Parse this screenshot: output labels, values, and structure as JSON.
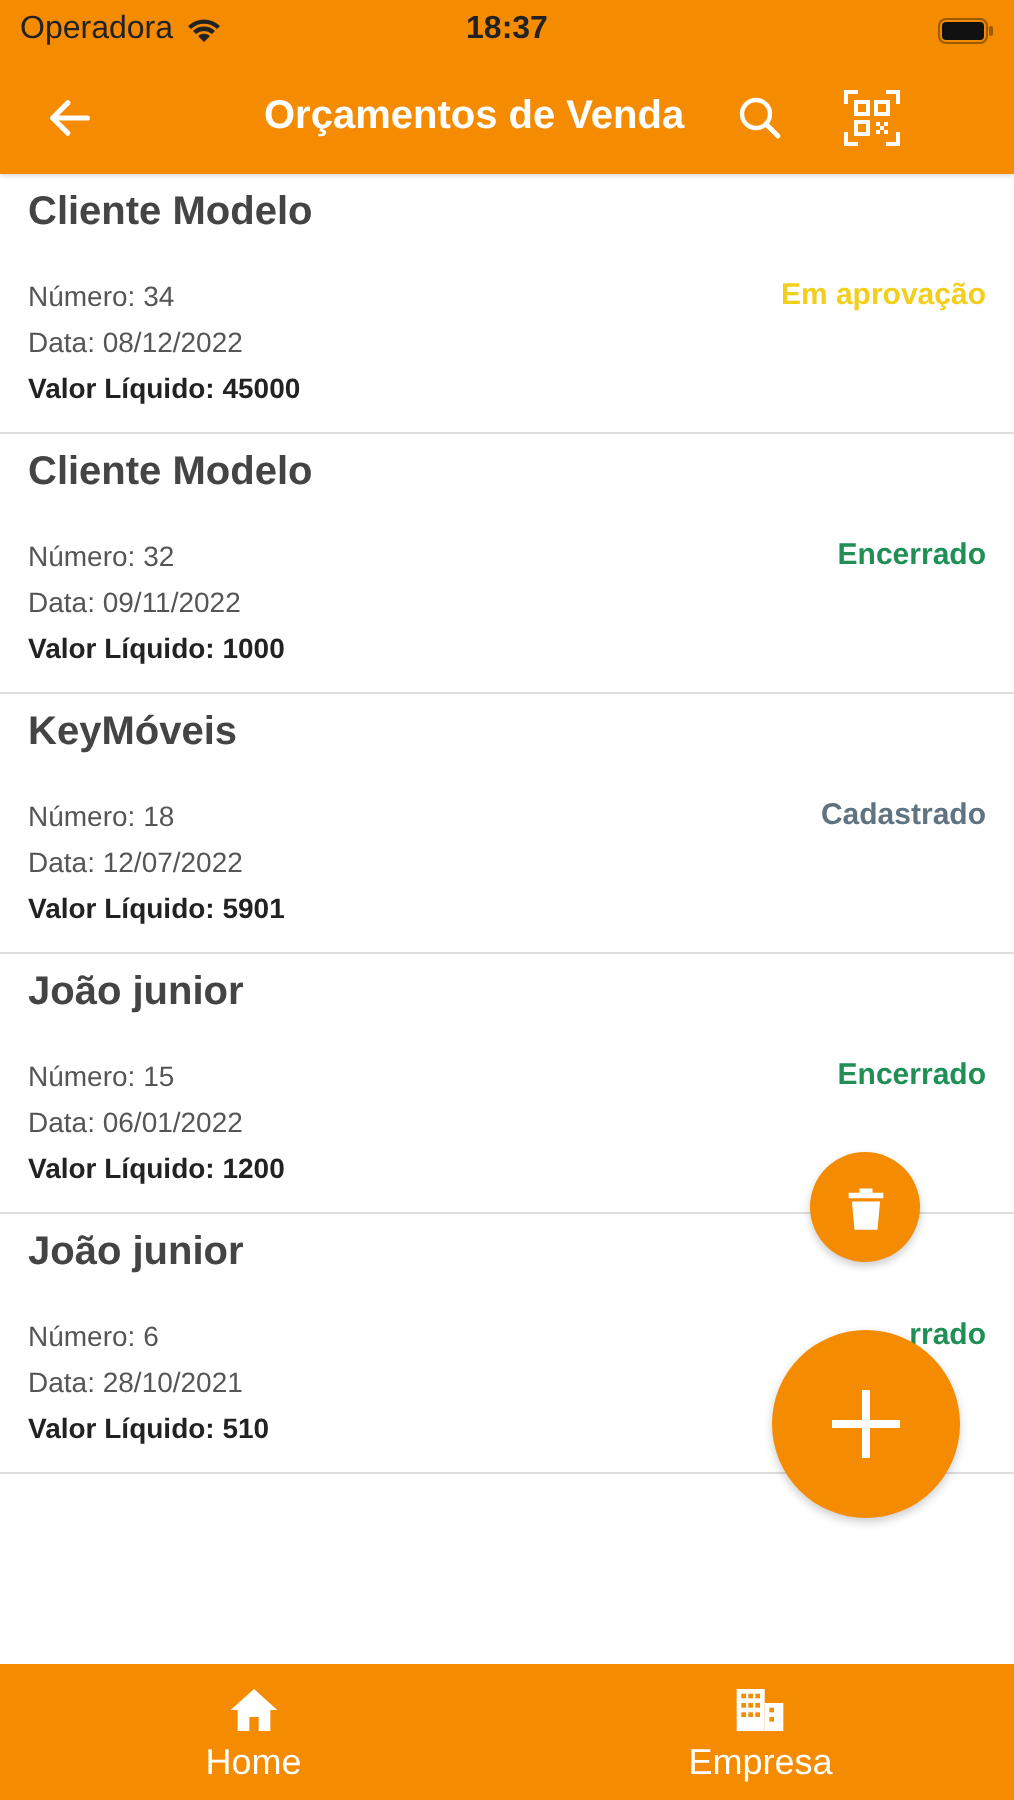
{
  "status_bar": {
    "carrier": "Operadora",
    "time": "18:37"
  },
  "header": {
    "title": "Orçamentos de Venda"
  },
  "quotes": [
    {
      "client": "Cliente Modelo",
      "number": "Número: 34",
      "date": "Data: 08/12/2022",
      "net_value": "Valor Líquido: 45000",
      "status": "Em aprovação",
      "color": "#f2cf1d"
    },
    {
      "client": "Cliente Modelo",
      "number": "Número: 32",
      "date": "Data: 09/11/2022",
      "net_value": "Valor Líquido: 1000",
      "status": "Encerrado",
      "color": "#1f8f55"
    },
    {
      "client": "KeyMóveis",
      "number": "Número: 18",
      "date": "Data: 12/07/2022",
      "net_value": "Valor Líquido: 5901",
      "status": "Cadastrado",
      "color": "#5f7480"
    },
    {
      "client": "João junior",
      "number": "Número: 15",
      "date": "Data: 06/01/2022",
      "net_value": "Valor Líquido: 1200",
      "status": "Encerrado",
      "color": "#1f8f55"
    },
    {
      "client": "João junior",
      "number": "Número: 6",
      "date": "Data: 28/10/2021",
      "net_value": "Valor Líquido: 510",
      "status": "rrado",
      "color": "#1f8f55"
    }
  ],
  "tab_bar": [
    {
      "label": "Home",
      "kind": "home"
    },
    {
      "label": "Empresa",
      "kind": "company"
    }
  ]
}
